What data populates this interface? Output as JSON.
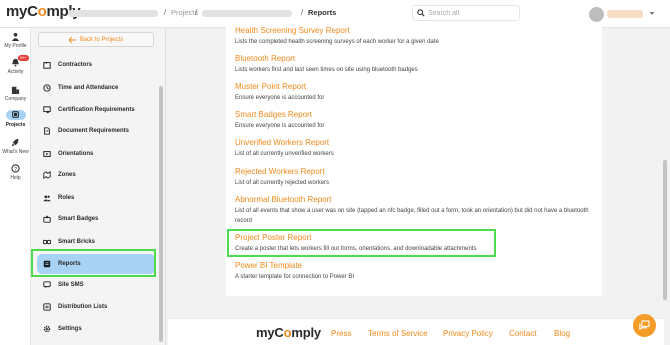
{
  "app": {
    "logo_pre": "my",
    "logo_mid": "C",
    "logo_o": "o",
    "logo_post": "mply"
  },
  "breadcrumb": {
    "projects": "Projects",
    "current": "Reports",
    "sep": "/"
  },
  "search": {
    "placeholder": "Search all",
    "icon": "search-icon"
  },
  "rail": {
    "profile": "My Profile",
    "activity": "Activity",
    "activity_badge": "99+",
    "company": "Company",
    "projects": "Projects",
    "whats_new": "What's New",
    "help": "Help"
  },
  "sidebar": {
    "back": "Back to Projects",
    "items": [
      {
        "label": "Contractors",
        "icon": "folder-icon"
      },
      {
        "label": "Time and Attendance",
        "icon": "clock-icon"
      },
      {
        "label": "Certification Requirements",
        "icon": "certificate-icon"
      },
      {
        "label": "Document Requirements",
        "icon": "document-icon"
      },
      {
        "label": "Orientations",
        "icon": "orientation-icon"
      },
      {
        "label": "Zones",
        "icon": "zones-icon"
      },
      {
        "label": "Roles",
        "icon": "roles-icon"
      },
      {
        "label": "Smart Badges",
        "icon": "badge-icon"
      },
      {
        "label": "Smart Bricks",
        "icon": "bricks-icon"
      },
      {
        "label": "Reports",
        "icon": "reports-icon"
      },
      {
        "label": "Site SMS",
        "icon": "sms-icon"
      },
      {
        "label": "Distribution Lists",
        "icon": "list-icon"
      },
      {
        "label": "Settings",
        "icon": "gear-icon"
      }
    ]
  },
  "reports": [
    {
      "title": "Health Screening Survey Report",
      "desc": "Lists the completed health screening surveys of each worker for a given date"
    },
    {
      "title": "Bluetooth Report",
      "desc": "Lists workers first and last seen times on site using bluetooth badges"
    },
    {
      "title": "Muster Point Report",
      "desc": "Ensure everyone is accounted for"
    },
    {
      "title": "Smart Badges Report",
      "desc": "Ensure everyone is accounted for"
    },
    {
      "title": "Unverified Workers Report",
      "desc": "List of all currently unverified workers"
    },
    {
      "title": "Rejected Workers Report",
      "desc": "List of all currently rejected workers"
    },
    {
      "title": "Abnormal Bluetooth Report",
      "desc": "List of all events that show a user was on site (tapped an nfc badge, filled out a form, took an orientation) but did not have a bluetooth record"
    },
    {
      "title": "Project Poster Report",
      "desc": "Create a poster that lets workers fill out forms, orientations, and downloadable attachments"
    },
    {
      "title": "Power BI Template",
      "desc": "A starter template for connection to Power BI"
    }
  ],
  "footer": {
    "links": [
      "Press",
      "Terms of Service",
      "Privacy Policy",
      "Contact",
      "Blog"
    ]
  },
  "colors": {
    "accent": "#f08a1c",
    "active": "#a9d3f5",
    "highlight": "#4ddc4d"
  }
}
